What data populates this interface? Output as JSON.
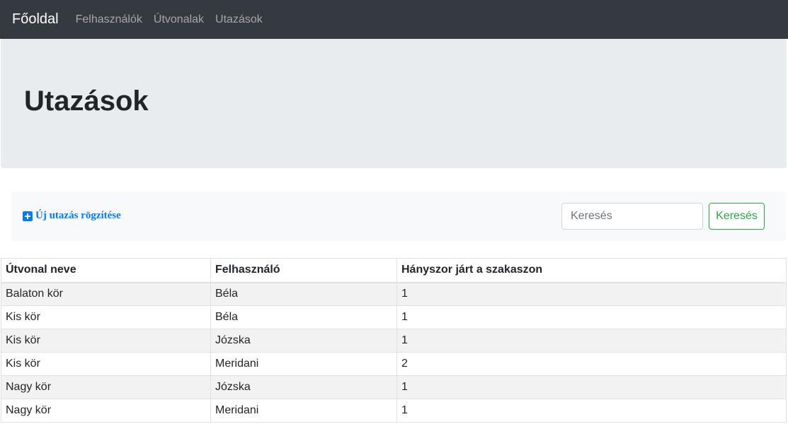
{
  "navbar": {
    "brand": "Főoldal",
    "links": [
      "Felhasználók",
      "Útvonalak",
      "Utazások"
    ]
  },
  "jumbotron": {
    "title": "Utazások"
  },
  "toolbar": {
    "new_label": "Új utazás rögzítése",
    "new_icon": "plus-square-icon",
    "search_placeholder": "Keresés",
    "search_button": "Keresés"
  },
  "table": {
    "headers": [
      "Útvonal neve",
      "Felhasználó",
      "Hányszor járt a szakaszon"
    ],
    "rows": [
      [
        "Balaton kör",
        "Béla",
        "1"
      ],
      [
        "Kis kör",
        "Béla",
        "1"
      ],
      [
        "Kis kör",
        "Józska",
        "1"
      ],
      [
        "Kis kör",
        "Meridani",
        "2"
      ],
      [
        "Nagy kör",
        "Józska",
        "1"
      ],
      [
        "Nagy kör",
        "Meridani",
        "1"
      ]
    ]
  },
  "colors": {
    "navbar_bg": "#343a40",
    "jumbotron_bg": "#e9ecef",
    "link": "#007bff",
    "success": "#28a745"
  }
}
